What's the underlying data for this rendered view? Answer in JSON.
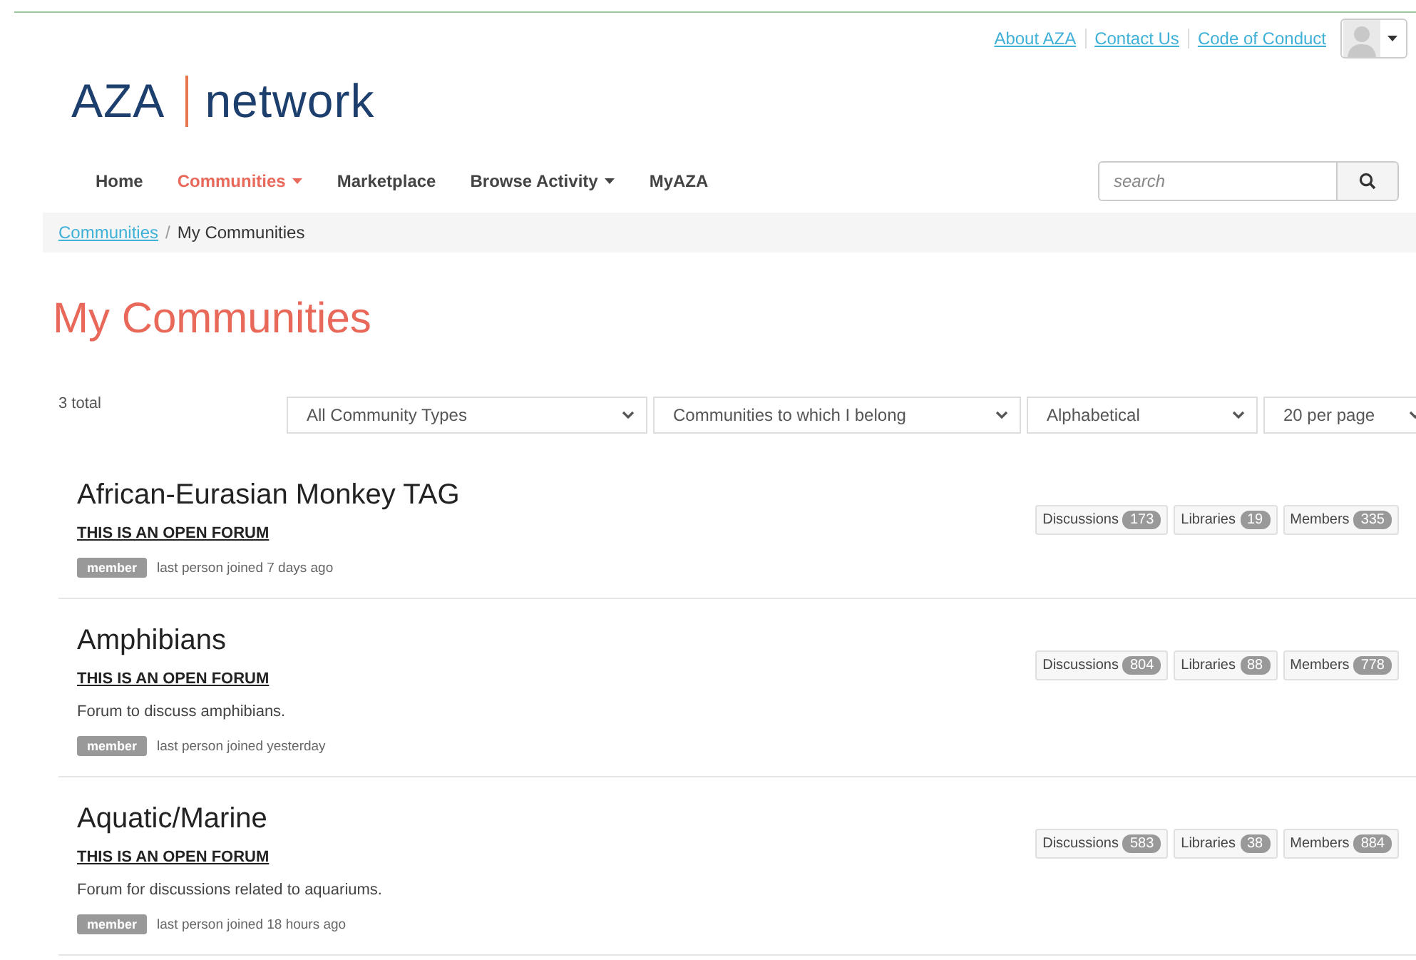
{
  "top_links": [
    "About AZA",
    "Contact Us",
    "Code of Conduct"
  ],
  "logo": {
    "left": "AZA",
    "right": "network"
  },
  "nav": [
    {
      "label": "Home",
      "selected": false,
      "dropdown": false
    },
    {
      "label": "Communities",
      "selected": true,
      "dropdown": true
    },
    {
      "label": "Marketplace",
      "selected": false,
      "dropdown": false
    },
    {
      "label": "Browse Activity",
      "selected": false,
      "dropdown": true
    },
    {
      "label": "MyAZA",
      "selected": false,
      "dropdown": false
    }
  ],
  "search": {
    "placeholder": "search"
  },
  "breadcrumb_separator": "/",
  "breadcrumb": [
    {
      "label": "Communities",
      "link": true
    },
    {
      "label": "My Communities",
      "link": false
    }
  ],
  "page_title": "My Communities",
  "total": "3 total",
  "filters": [
    "All Community Types",
    "Communities to which I belong",
    "Alphabetical",
    "20 per page"
  ],
  "communities": [
    {
      "name": "African-Eurasian Monkey TAG",
      "forum": "THIS IS AN OPEN FORUM",
      "badge": "member",
      "joined": "last person joined 7 days ago",
      "stats": [
        {
          "label": "Discussions",
          "count": "173"
        },
        {
          "label": "Libraries",
          "count": "19"
        },
        {
          "label": "Members",
          "count": "335"
        }
      ]
    },
    {
      "name": "Amphibians",
      "forum": "THIS IS AN OPEN FORUM",
      "description": "Forum to discuss amphibians.",
      "badge": "member",
      "joined": "last person joined yesterday",
      "stats": [
        {
          "label": "Discussions",
          "count": "804"
        },
        {
          "label": "Libraries",
          "count": "88"
        },
        {
          "label": "Members",
          "count": "778"
        }
      ]
    },
    {
      "name": "Aquatic/Marine",
      "forum": "THIS IS AN OPEN FORUM",
      "description": "Forum for discussions related to aquariums.",
      "badge": "member",
      "joined": "last person joined 18 hours ago",
      "stats": [
        {
          "label": "Discussions",
          "count": "583"
        },
        {
          "label": "Libraries",
          "count": "38"
        },
        {
          "label": "Members",
          "count": "884"
        }
      ]
    }
  ]
}
